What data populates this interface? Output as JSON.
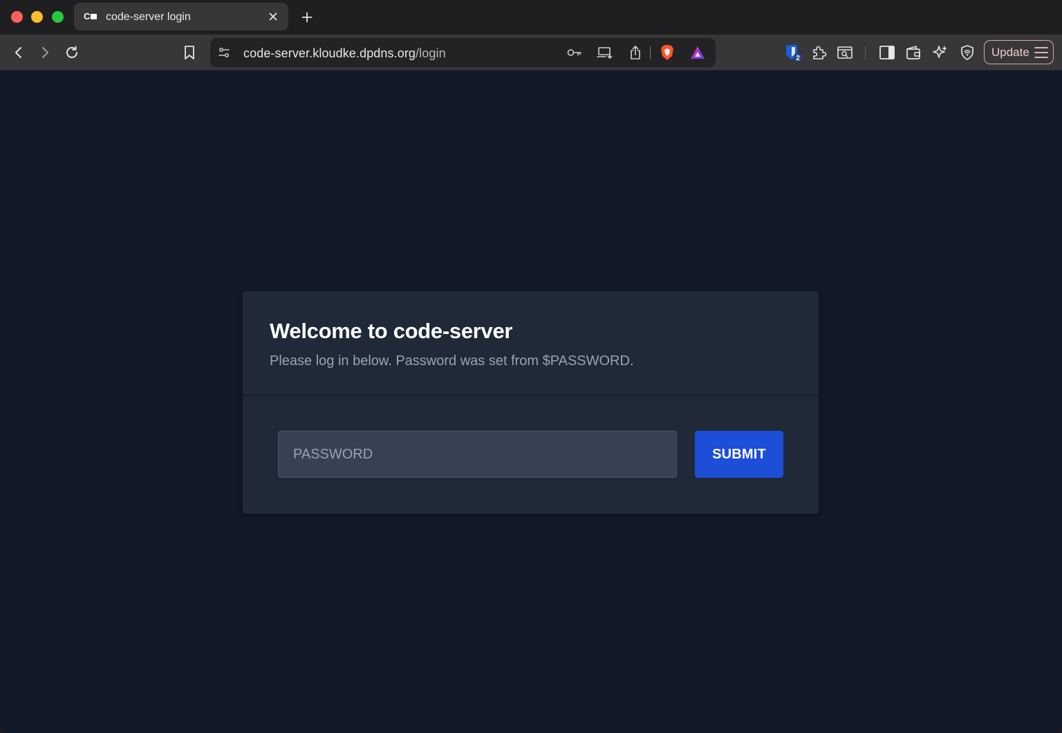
{
  "browser": {
    "tab": {
      "title": "code-server login",
      "favicon_text": "C"
    },
    "address": {
      "host": "code-server.kloudke.dpdns.org",
      "path": "/login"
    },
    "extensions": {
      "bitwarden_badge": "2"
    },
    "update_label": "Update"
  },
  "login": {
    "title": "Welcome to code-server",
    "subtitle": "Please log in below. Password was set from $PASSWORD.",
    "password_placeholder": "PASSWORD",
    "submit_label": "SUBMIT"
  },
  "colors": {
    "page_bg": "#111827",
    "card_bg": "#1f2937",
    "input_bg": "#374151",
    "submit_bg": "#1d4ed8",
    "brave_orange": "#fb542b",
    "update_border": "#e0a6a6"
  },
  "icons": [
    "back-icon",
    "forward-icon",
    "reload-icon",
    "bookmark-icon",
    "site-settings-icon",
    "key-icon",
    "cast-icon",
    "share-icon",
    "brave-shields-icon",
    "brave-rewards-icon",
    "bitwarden-icon",
    "extensions-icon",
    "screenshot-icon",
    "sidebar-icon",
    "wallet-icon",
    "leo-ai-icon",
    "vpn-icon",
    "menu-icon"
  ]
}
